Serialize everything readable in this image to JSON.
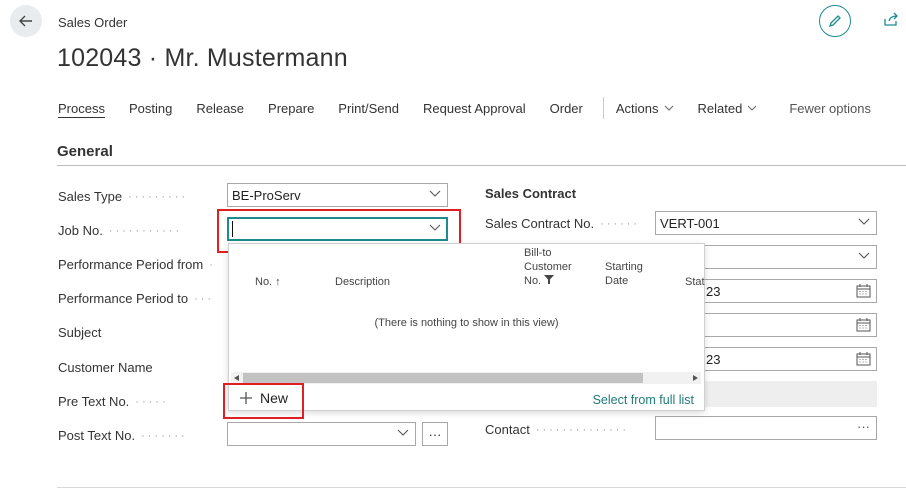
{
  "header": {
    "breadcrumb": "Sales Order",
    "title": "102043 · Mr. Mustermann"
  },
  "actionbar": {
    "items": [
      "Process",
      "Posting",
      "Release",
      "Prepare",
      "Print/Send",
      "Request Approval",
      "Order"
    ],
    "actions_label": "Actions",
    "related_label": "Related",
    "fewer_options": "Fewer options"
  },
  "general": {
    "section_title": "General",
    "sales_type_label": "Sales Type",
    "sales_type_value": "BE-ProServ",
    "job_no_label": "Job No.",
    "job_no_value": "",
    "performance_from_label": "Performance Period from",
    "performance_to_label": "Performance Period to",
    "subject_label": "Subject",
    "customer_name_label": "Customer Name",
    "pre_text_label": "Pre Text No.",
    "post_text_label": "Post Text No."
  },
  "sales_contract": {
    "title": "Sales Contract",
    "contract_no_label": "Sales Contract No.",
    "contract_no_value": "VERT-001",
    "date_partial_1": "23",
    "date_partial_2": "23",
    "contact_label": "Contact"
  },
  "lookup": {
    "col_no": "No. ↑",
    "col_description": "Description",
    "col_billto": "Bill-to\nCustomer\nNo.",
    "col_starting": "Starting\nDate",
    "col_status_partial": "Stat",
    "empty_message": "(There is nothing to show in this view)",
    "new_label": "New",
    "select_full_list": "Select from full list"
  },
  "colors": {
    "accent": "#1e8c8c",
    "highlight": "#e02020"
  }
}
